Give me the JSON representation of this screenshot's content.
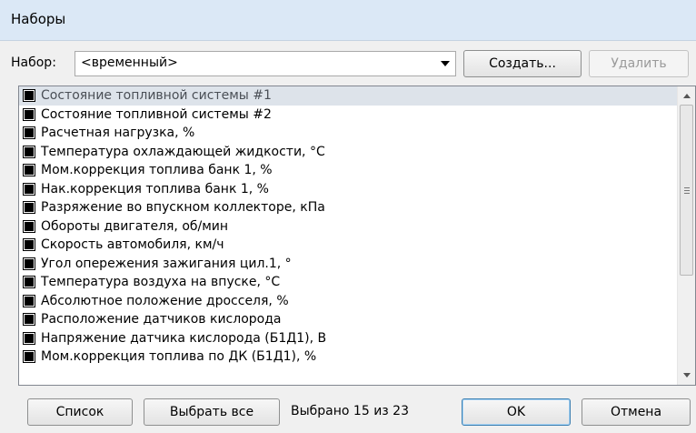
{
  "window": {
    "title": "Наборы"
  },
  "set": {
    "label": "Набор:",
    "value": "<временный>",
    "create_label": "Создать...",
    "delete_label": "Удалить"
  },
  "items": [
    {
      "label": "Состояние топливной системы #1",
      "checked": true,
      "selected": true
    },
    {
      "label": "Состояние топливной системы #2",
      "checked": true
    },
    {
      "label": "Расчетная нагрузка, %",
      "checked": true
    },
    {
      "label": "Температура охлаждающей жидкости, °С",
      "checked": true
    },
    {
      "label": "Мом.коррекция топлива банк 1, %",
      "checked": true
    },
    {
      "label": "Нак.коррекция топлива банк 1, %",
      "checked": true
    },
    {
      "label": "Разряжение во впускном коллекторе, кПа",
      "checked": true
    },
    {
      "label": "Обороты двигателя, об/мин",
      "checked": true
    },
    {
      "label": "Скорость автомобиля, км/ч",
      "checked": true
    },
    {
      "label": "Угол опережения зажигания цил.1, °",
      "checked": true
    },
    {
      "label": "Температура воздуха на впуске, °С",
      "checked": true
    },
    {
      "label": "Абсолютное положение дросселя, %",
      "checked": true
    },
    {
      "label": "Расположение датчиков кислорода",
      "checked": true
    },
    {
      "label": "Напряжение датчика кислорода (Б1Д1), В",
      "checked": true
    },
    {
      "label": "Мом.коррекция топлива по ДК (Б1Д1), %",
      "checked": true
    }
  ],
  "bottom": {
    "list_label": "Список",
    "select_all_label": "Выбрать все",
    "status": "Выбрано 15 из 23",
    "ok_label": "OK",
    "cancel_label": "Отмена"
  }
}
